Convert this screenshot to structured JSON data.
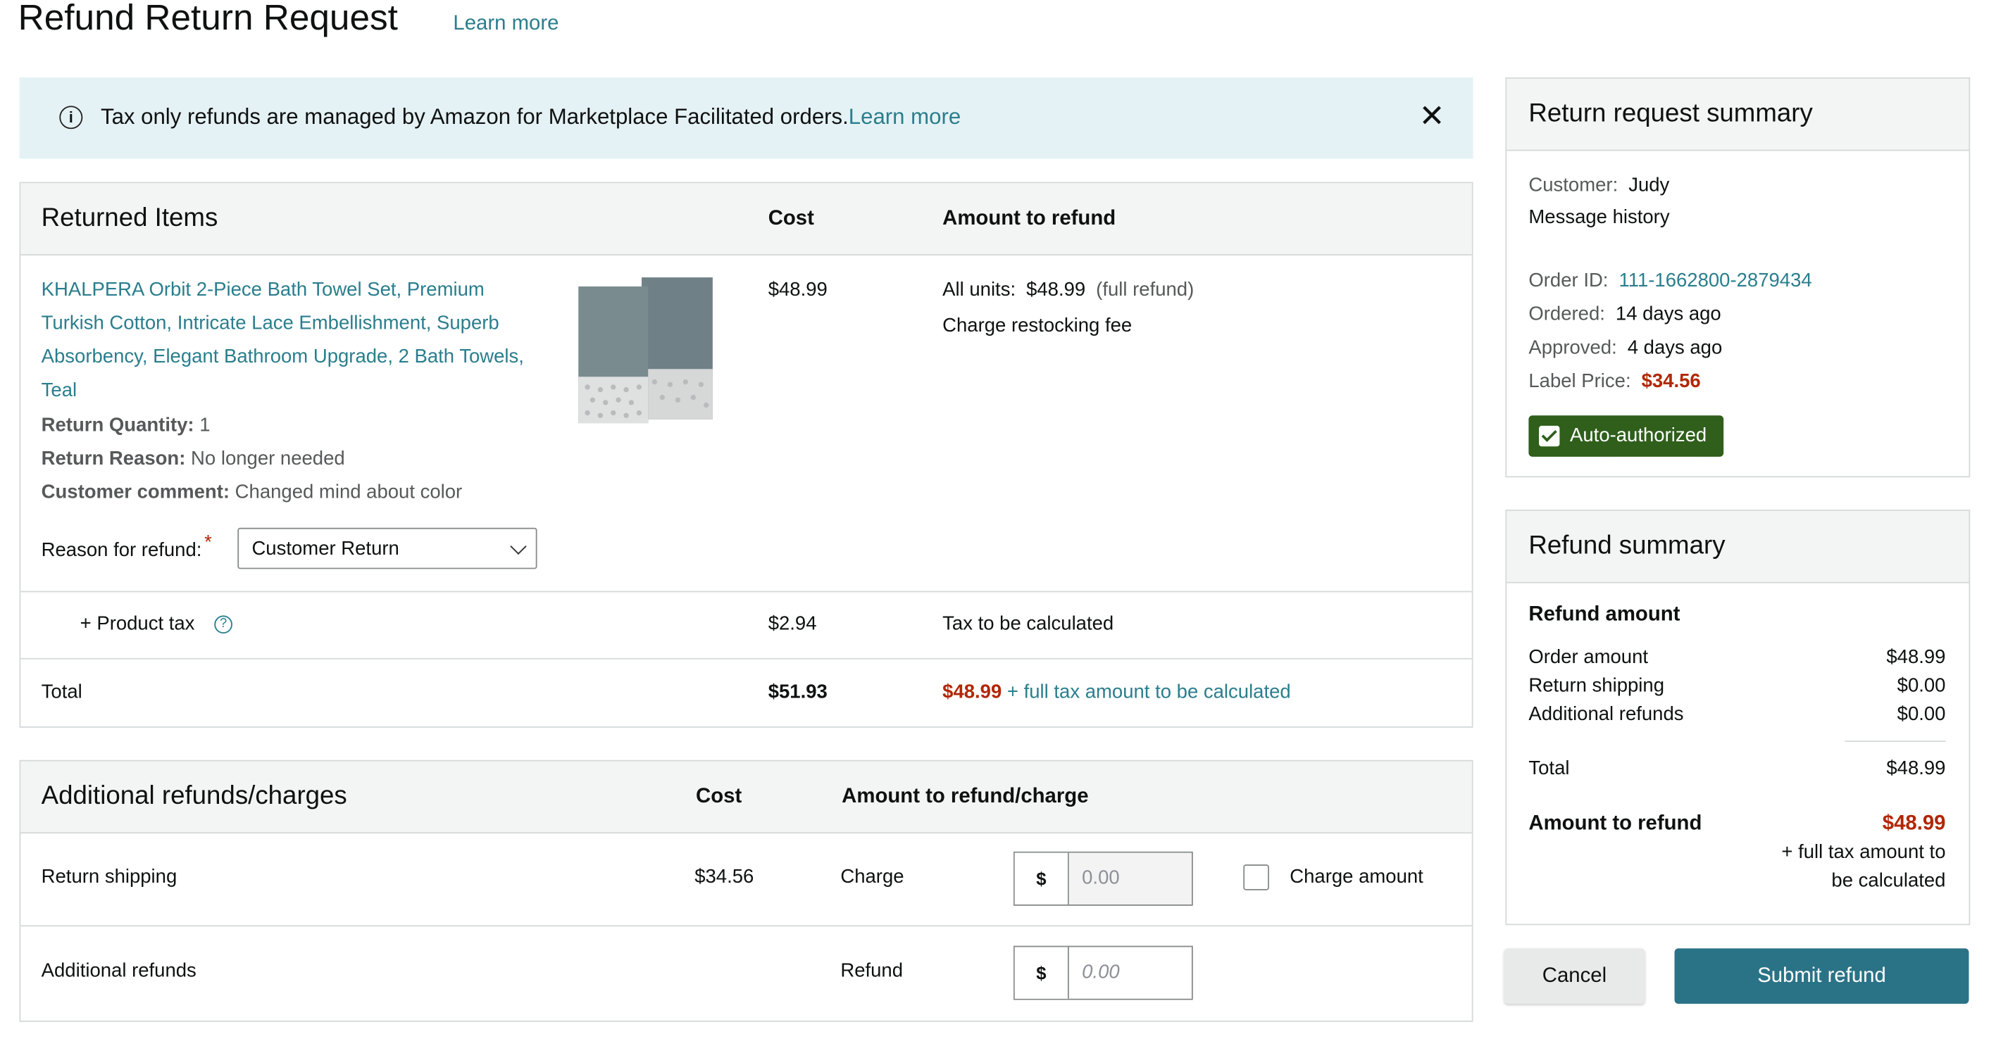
{
  "page": {
    "title": "Refund Return Request",
    "learn_more": "Learn more"
  },
  "banner": {
    "icon": "info-icon",
    "text": "Tax only refunds are managed by Amazon for Marketplace Facilitated orders.",
    "link": "Learn more",
    "close_icon": "close-icon"
  },
  "returned_items": {
    "title": "Returned Items",
    "col_cost": "Cost",
    "col_amount": "Amount to refund",
    "product": {
      "title": "KHALPERA Orbit 2-Piece Bath Towel Set, Premium Turkish Cotton, Intricate Lace Embellishment, Superb Absorbency, Elegant Bathroom Upgrade, 2 Bath Towels, Teal",
      "image": "towel-set-image",
      "return_quantity_label": "Return Quantity:",
      "return_quantity": "1",
      "return_reason_label": "Return Reason:",
      "return_reason": "No longer needed",
      "comment_label": "Customer comment:",
      "comment": "Changed mind about color",
      "cost": "$48.99",
      "all_units_label": "All units:",
      "all_units_value": "$48.99",
      "all_units_note": "(full refund)",
      "restocking_link": "Charge restocking fee"
    },
    "reason_label": "Reason for refund:",
    "required_mark": "*",
    "reason_value": "Customer Return",
    "tax": {
      "label": "+ Product tax",
      "help_icon": "?",
      "cost": "$2.94",
      "amount": "Tax to be calculated"
    },
    "total": {
      "label": "Total",
      "cost": "$51.93",
      "amount": "$48.99",
      "amount_note": "+ full tax amount to be calculated"
    }
  },
  "additional": {
    "title": "Additional refunds/charges",
    "col_cost": "Cost",
    "col_amount": "Amount to refund/charge",
    "shipping": {
      "label": "Return shipping",
      "cost": "$34.56",
      "action": "Charge",
      "currency": "$",
      "placeholder": "0.00",
      "checkbox_label": "Charge amount"
    },
    "refunds": {
      "label": "Additional refunds",
      "action": "Refund",
      "currency": "$",
      "placeholder": "0.00"
    }
  },
  "summary": {
    "title": "Return request summary",
    "customer_label": "Customer:",
    "customer": "Judy",
    "message_history": "Message history",
    "order_id_label": "Order ID:",
    "order_id": "111-1662800-2879434",
    "ordered_label": "Ordered:",
    "ordered": "14 days ago",
    "approved_label": "Approved:",
    "approved": "4 days ago",
    "label_price_label": "Label Price:",
    "label_price": "$34.56",
    "badge": "Auto-authorized"
  },
  "refund_summary": {
    "title": "Refund summary",
    "refund_amount_heading": "Refund amount",
    "rows": [
      {
        "label": "Order amount",
        "value": "$48.99"
      },
      {
        "label": "Return shipping",
        "value": "$0.00"
      },
      {
        "label": "Additional refunds",
        "value": "$0.00"
      }
    ],
    "total_label": "Total",
    "total_value": "$48.99",
    "amount_to_refund_label": "Amount to refund",
    "amount_to_refund_value": "$48.99",
    "tax_note_line1": "+ full tax amount to",
    "tax_note_line2": "be calculated"
  },
  "buttons": {
    "cancel": "Cancel",
    "submit": "Submit refund"
  },
  "colors": {
    "link": "#2a7e8d",
    "price_red": "#b12704",
    "primary_button": "#2a7387",
    "badge_green": "#2f5f1b",
    "banner_bg": "#e5f2f5"
  }
}
